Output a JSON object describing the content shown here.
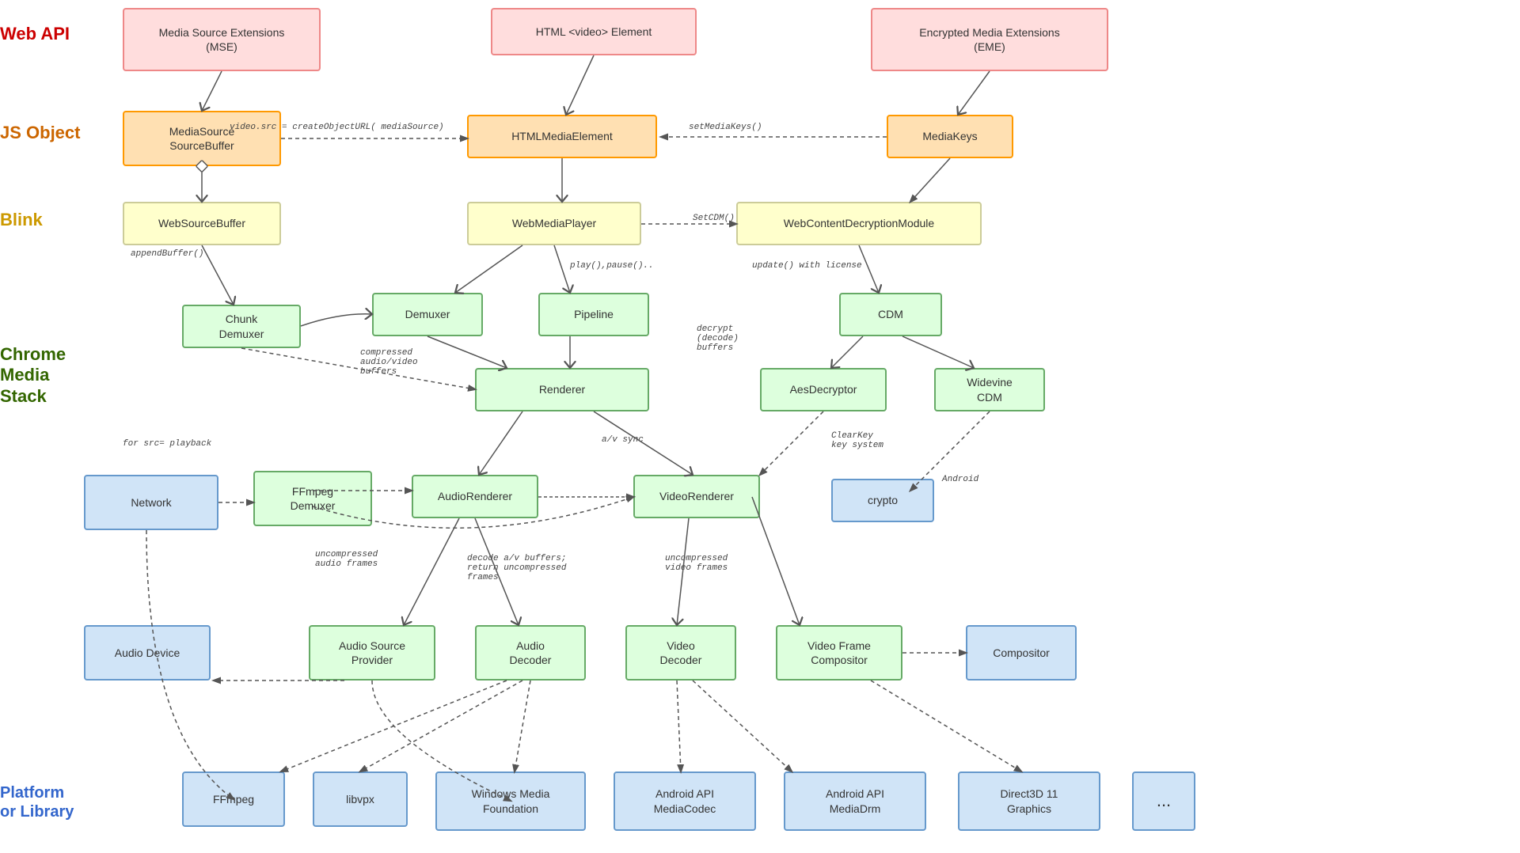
{
  "labels": {
    "webapi": "Web API",
    "jsobject": "JS Object",
    "blink": "Blink",
    "cms": "Chrome\nMedia\nStack",
    "platform": "Platform\nor Library"
  },
  "boxes": {
    "mse": "Media Source Extensions\n(MSE)",
    "html_video": "HTML <video> Element",
    "eme": "Encrypted Media Extensions\n(EME)",
    "mediasource": "MediaSource\nSourceBuffer",
    "htmlmediaelement": "HTMLMediaElement",
    "mediakeys": "MediaKeys",
    "websourcebuffer": "WebSourceBuffer",
    "webmediaplayer": "WebMediaPlayer",
    "webcontentdecryptionmodule": "WebContentDecryptionModule",
    "chunk_demuxer": "Chunk\nDemuxer",
    "demuxer": "Demuxer",
    "pipeline": "Pipeline",
    "cdm": "CDM",
    "renderer": "Renderer",
    "aesdecryptor": "AesDecryptor",
    "widevine_cdm": "Widevine\nCDM",
    "network": "Network",
    "ffmpeg_demuxer": "FFmpeg\nDemuxer",
    "audiorenderer": "AudioRenderer",
    "videorenderer": "VideoRenderer",
    "crypto": "crypto",
    "audio_device": "Audio Device",
    "audio_source_provider": "Audio Source\nProvider",
    "audio_decoder": "Audio\nDecoder",
    "video_decoder": "Video\nDecoder",
    "video_frame_compositor": "Video Frame\nCompositor",
    "compositor": "Compositor",
    "ffmpeg": "FFmpeg",
    "libvpx": "libvpx",
    "wmf": "Windows Media\nFoundation",
    "android_mediacodec": "Android API\nMediaCodec",
    "android_mediadrm": "Android API\nMediaDrm",
    "direct3d": "Direct3D 11\nGraphics",
    "dots": "..."
  },
  "annotations": {
    "video_src": "video.src =\ncreateObjectURL(\nmediaSource)",
    "set_media_keys": "setMediaKeys()",
    "append_buffer": "appendBuffer()",
    "set_cdm": "SetCDM()",
    "play_pause": "play(),pause()..",
    "update_license": "update() with license",
    "compressed_buffers": "compressed\naudio/video\nbuffers",
    "decrypt_buffers": "decrypt\n(decode)\nbuffers",
    "for_src_playback": "for src= playback",
    "av_sync": "a/v\nsync",
    "uncompressed_audio": "uncompressed\naudio frames",
    "decode_av": "decode a/v buffers;\nreturn uncompressed\nframes",
    "uncompressed_video": "uncompressed\nvideo frames",
    "clearkey": "ClearKey\nkey system",
    "android": "Android"
  }
}
